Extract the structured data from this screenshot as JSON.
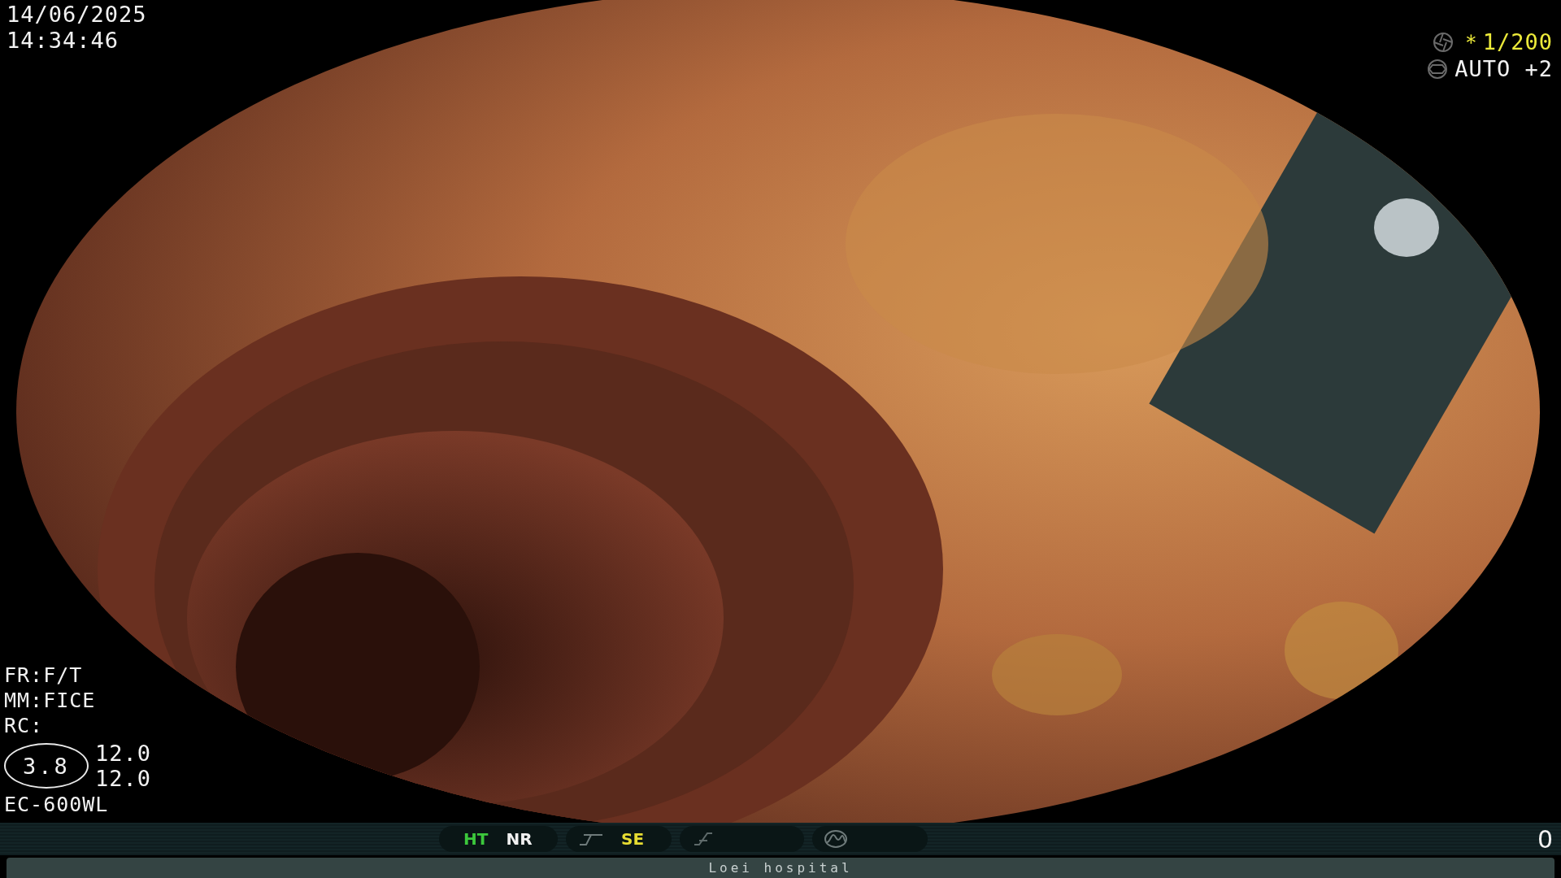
{
  "overlay": {
    "date": "14/06/2025",
    "time": "14:34:46",
    "shutter": "＊1/200",
    "exposure": "AUTO +2",
    "settings": [
      "FR:F/T",
      "MM:FICE",
      "RC:"
    ],
    "iris": "3.8",
    "readings": [
      "12.0",
      "12.0"
    ],
    "scope": "EC-600WL"
  },
  "status_bar": {
    "indicators": [
      {
        "label": "HT",
        "color": "#3cc83c"
      },
      {
        "label": "NR",
        "color": "#f0f0f0"
      },
      {
        "label": "SE",
        "color": "#e6dc32"
      }
    ],
    "counter": "0"
  },
  "footer": {
    "text": "Loei hospital"
  }
}
